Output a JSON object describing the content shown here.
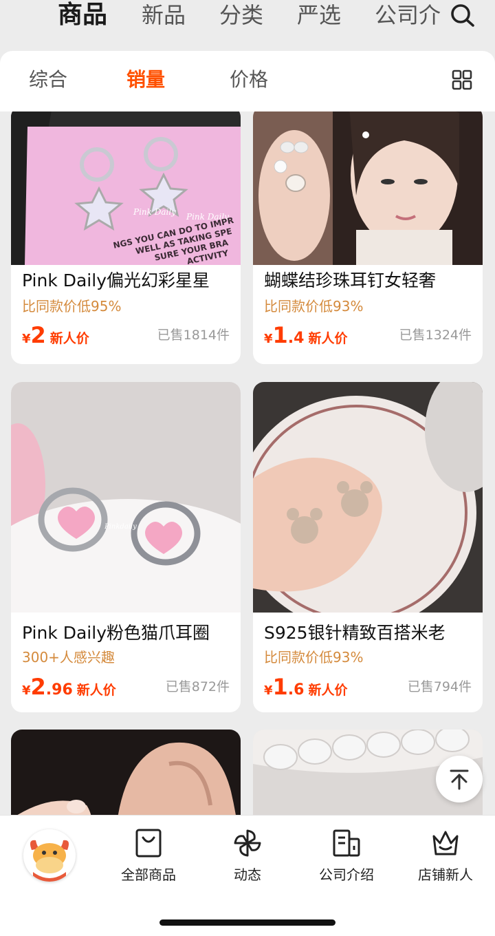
{
  "top_tabs": [
    "商品",
    "新品",
    "分类",
    "严选",
    "公司介"
  ],
  "sort_tabs": [
    "综合",
    "销量",
    "价格"
  ],
  "products": [
    {
      "title": "Pink Daily偏光幻彩星星",
      "subtitle": "比同款价低95%",
      "price_symbol": "¥",
      "price_int": "2",
      "price_dec": "",
      "price_tag": "新人价",
      "sold": "已售1814件",
      "image_text": {
        "brand1": "Pink Daily",
        "brand2": "Pink Daily",
        "line1": "NGS YOU CAN DO TO IMPR",
        "line2": "WELL AS TAKING SPE",
        "line3": "SURE YOUR BRA",
        "line4": "ACTIVITY"
      }
    },
    {
      "title": "蝴蝶结珍珠耳钉女轻奢",
      "subtitle": "比同款价低93%",
      "price_symbol": "¥",
      "price_int": "1",
      "price_dec": ".4",
      "price_tag": "新人价",
      "sold": "已售1324件"
    },
    {
      "title": "Pink Daily粉色猫爪耳圈",
      "subtitle": "300+人感兴趣",
      "price_symbol": "¥",
      "price_int": "2",
      "price_dec": ".96",
      "price_tag": "新人价",
      "sold": "已售872件",
      "image_text": {
        "brand": "Pinkdaily"
      }
    },
    {
      "title": "S925银针精致百搭米老",
      "subtitle": "比同款价低93%",
      "price_symbol": "¥",
      "price_int": "1",
      "price_dec": ".6",
      "price_tag": "新人价",
      "sold": "已售794件"
    }
  ],
  "bottom_nav": [
    "全部商品",
    "动态",
    "公司介绍",
    "店铺新人"
  ],
  "icons": {
    "search": "search-icon",
    "grid": "grid-view-icon",
    "back_top": "back-to-top-icon",
    "all_goods": "shopping-bag-icon",
    "feed": "pinwheel-icon",
    "company": "building-icon",
    "newcomer": "crown-icon",
    "shop_avatar": "ox-avatar-icon"
  },
  "colors": {
    "accent": "#ff5000",
    "price": "#ff3c00",
    "subtitle": "#d48a3c",
    "muted": "#999999",
    "background": "#ececec"
  }
}
